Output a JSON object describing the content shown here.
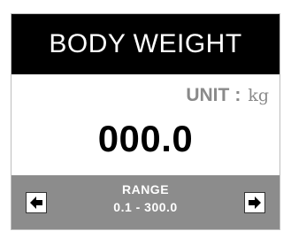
{
  "title": "BODY WEIGHT",
  "unit": {
    "label": "UNIT",
    "separator": ":",
    "value": "kg"
  },
  "display": {
    "value": "000.0"
  },
  "range": {
    "label": "RANGE",
    "values": "0.1 - 300.0"
  },
  "icons": {
    "prev": "left-arrow-icon",
    "next": "right-arrow-icon"
  },
  "colors": {
    "title_bg": "#000000",
    "title_text": "#ffffff",
    "unit_text": "#8a8a8a",
    "value_text": "#000000",
    "range_bg": "#8c8c8c",
    "range_text": "#ffffff"
  }
}
